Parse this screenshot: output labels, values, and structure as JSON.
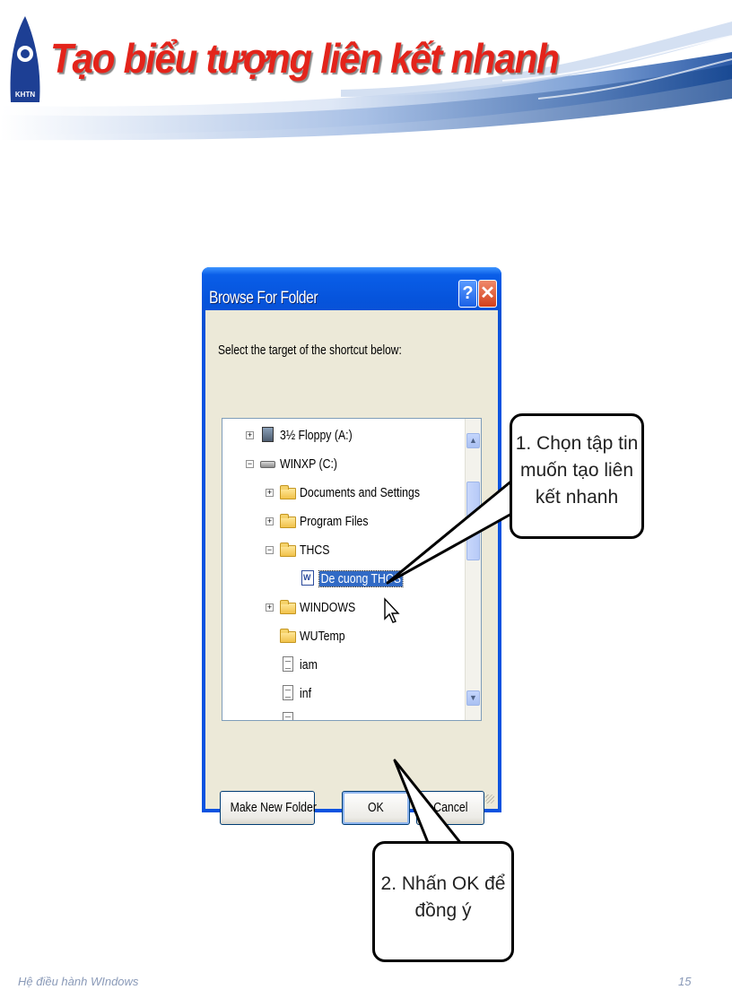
{
  "slide": {
    "title": "Tạo biểu tượng liên kết nhanh",
    "logo_text": "KHTN",
    "footer_left": "Hệ điều hành WIndows",
    "page_number": "15"
  },
  "dialog": {
    "title": "Browse For Folder",
    "help_glyph": "?",
    "close_glyph": "✕",
    "prompt": "Select the target of the shortcut below:",
    "tree": [
      {
        "label": "3½ Floppy (A:)",
        "icon": "floppy-icon",
        "expander": "+"
      },
      {
        "label": "WINXP (C:)",
        "icon": "drive-icon",
        "expander": "−"
      },
      {
        "label": "Documents and Settings",
        "icon": "folder-icon",
        "expander": "+"
      },
      {
        "label": "Program Files",
        "icon": "folder-icon",
        "expander": "+"
      },
      {
        "label": "THCS",
        "icon": "folder-icon",
        "expander": "−"
      },
      {
        "label": "De cuong THCS",
        "icon": "word-document-icon",
        "selected": true
      },
      {
        "label": "WINDOWS",
        "icon": "folder-icon",
        "expander": "+"
      },
      {
        "label": "WUTemp",
        "icon": "folder-icon"
      },
      {
        "label": "iam",
        "icon": "text-file-icon"
      },
      {
        "label": "inf",
        "icon": "text-file-icon"
      }
    ],
    "buttons": {
      "make_new_folder": "Make New Folder",
      "ok": "OK",
      "cancel": "Cancel"
    }
  },
  "callouts": {
    "step1_line1": "1. Chọn tập tin",
    "step1_line2": "muốn tạo liên",
    "step1_line3": "kết nhanh",
    "step2_line1": "2. Nhấn OK để",
    "step2_line2": "đồng ý"
  },
  "colors": {
    "title_red": "#e3241b",
    "xp_blue": "#0a53e0",
    "dialog_face": "#ece9d8",
    "selection": "#316ac5"
  }
}
